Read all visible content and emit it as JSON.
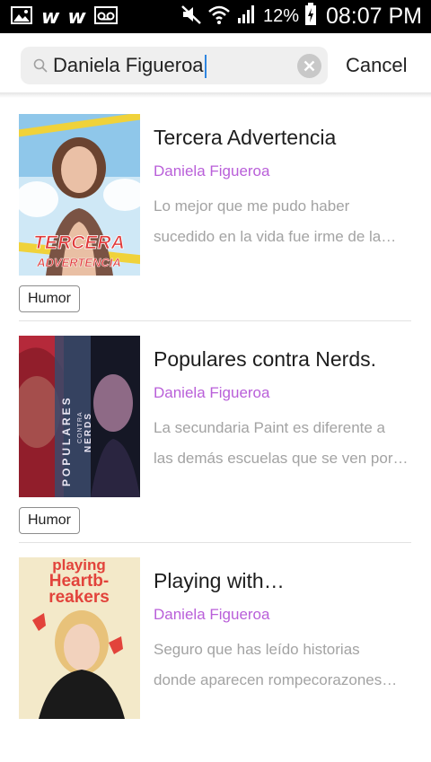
{
  "status_bar": {
    "battery_percent": "12%",
    "time": "08:07 PM",
    "icons": [
      "image-icon",
      "wattpad-icon",
      "wattpad-icon",
      "voicemail-icon",
      "mute-icon",
      "wifi-icon",
      "signal-icon",
      "battery-charging-icon"
    ],
    "app_letter": "w"
  },
  "search": {
    "query": "Daniela Figueroa",
    "cancel_label": "Cancel",
    "icons": [
      "search-icon",
      "clear-icon"
    ]
  },
  "results": [
    {
      "title": "Tercera Advertencia",
      "author": "Daniela Figueroa",
      "description_lines": [
        "Lo mejor que me pudo haber",
        "sucedido en la vida fue irme de la…"
      ],
      "tag": "Humor",
      "cover_text": [
        "TERCERA",
        "ADVERTENCIA"
      ],
      "cover_colors": [
        "#8fc7ea",
        "#e03a3a",
        "#f0d23a"
      ]
    },
    {
      "title": "Populares contra Nerds.",
      "author": "Daniela Figueroa",
      "description_lines": [
        "La secundaria Paint es diferente a",
        "las demás escuelas que se ven por…"
      ],
      "tag": "Humor",
      "cover_text": [
        "POPULARES",
        "CONTRA",
        "NERDS"
      ],
      "cover_colors": [
        "#b5293a",
        "#3b4a6b",
        "#151725"
      ]
    },
    {
      "title": "Playing with…",
      "author": "Daniela Figueroa",
      "description_lines": [
        "Seguro que has leído historias",
        "donde aparecen rompecorazones…"
      ],
      "cover_text": [
        "playing",
        "Heartb-",
        "reakers"
      ],
      "cover_colors": [
        "#f3e9c9",
        "#e2433b",
        "#e8c27a"
      ]
    }
  ]
}
